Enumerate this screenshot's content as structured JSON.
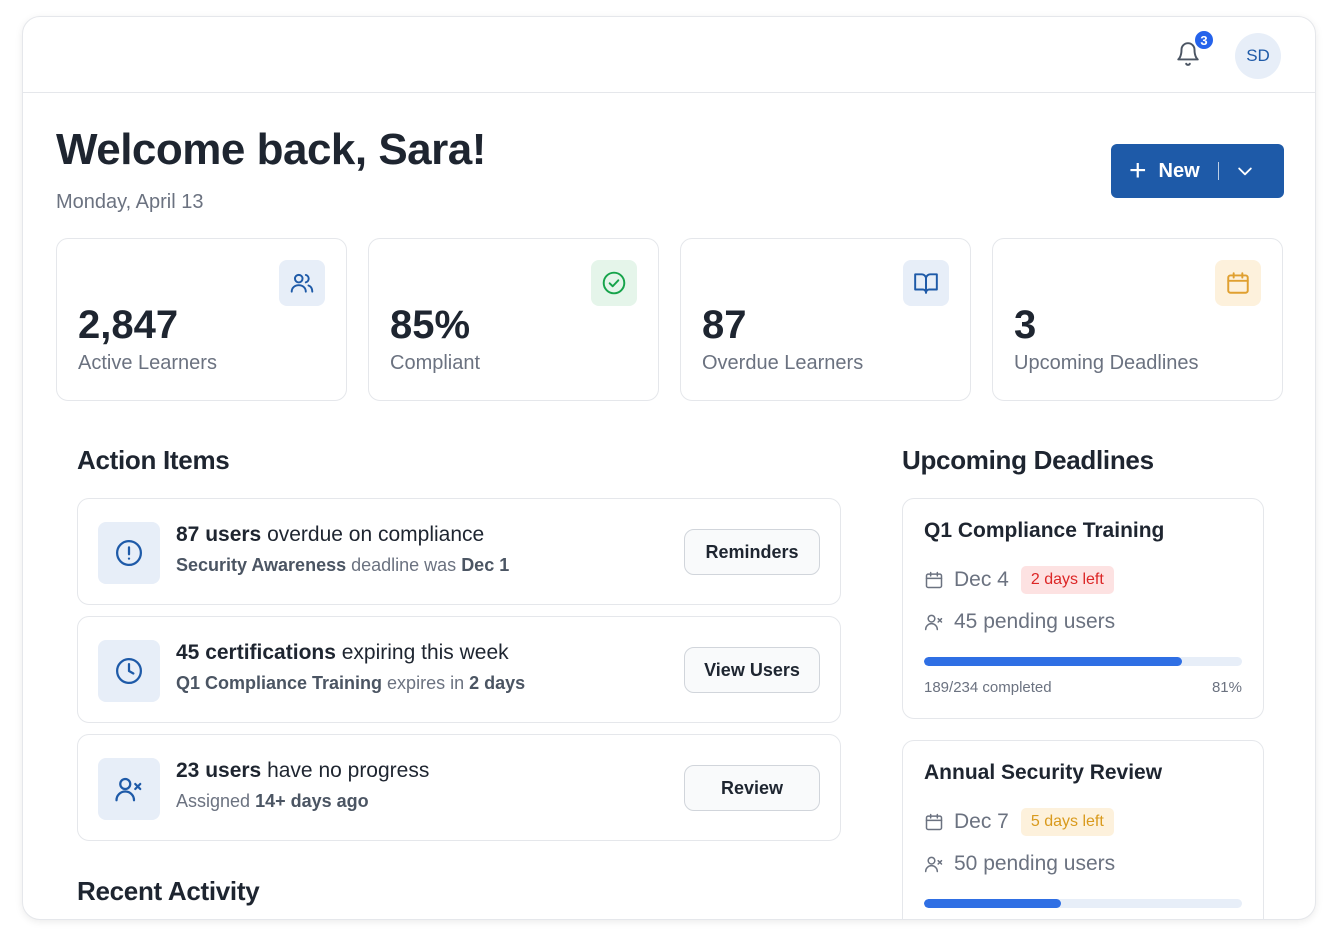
{
  "header": {
    "notifications_count": "3",
    "avatar_initials": "SD"
  },
  "page": {
    "welcome": "Welcome back, Sara!",
    "date": "Monday, April 13",
    "new_button_label": "New"
  },
  "stats": [
    {
      "value": "2,847",
      "label": "Active Learners",
      "icon": "users-icon",
      "icon_bg": "#e7eef8",
      "icon_color": "#1e5aa8"
    },
    {
      "value": "85%",
      "label": "Compliant",
      "icon": "check-circle-icon",
      "icon_bg": "#e5f5ea",
      "icon_color": "#16a34a"
    },
    {
      "value": "87",
      "label": "Overdue Learners",
      "icon": "book-open-icon",
      "icon_bg": "#e7eef8",
      "icon_color": "#1e5aa8"
    },
    {
      "value": "3",
      "label": "Upcoming Deadlines",
      "icon": "calendar-icon",
      "icon_bg": "#fdf1dc",
      "icon_color": "#e0a030"
    }
  ],
  "action_items": {
    "title": "Action Items",
    "items": [
      {
        "icon": "alert-circle-icon",
        "strong": "87 users",
        "text": " overdue on compliance",
        "sub_strong1": "Security Awareness",
        "sub_text": " deadline was ",
        "sub_strong2": "Dec 1",
        "button": "Reminders"
      },
      {
        "icon": "clock-icon",
        "strong": "45 certifications",
        "text": " expiring this week",
        "sub_strong1": "Q1 Compliance Training",
        "sub_text": " expires in ",
        "sub_strong2": "2 days",
        "button": "View Users"
      },
      {
        "icon": "user-x-icon",
        "strong": "23 users",
        "text": " have no progress",
        "sub_strong1": "",
        "sub_text": "Assigned ",
        "sub_strong2": "14+ days ago",
        "button": "Review"
      }
    ]
  },
  "recent_activity": {
    "title": "Recent Activity"
  },
  "upcoming_deadlines": {
    "title": "Upcoming Deadlines",
    "items": [
      {
        "title": "Q1 Compliance Training",
        "date": "Dec 4",
        "pill": "2 days left",
        "pill_tone": "red",
        "pending": "45 pending users",
        "progress": 0.81,
        "completed": "189/234 completed",
        "percent": "81%"
      },
      {
        "title": "Annual Security Review",
        "date": "Dec 7",
        "pill": "5 days left",
        "pill_tone": "amber",
        "pending": "50 pending users",
        "progress": 0.43
      }
    ]
  }
}
